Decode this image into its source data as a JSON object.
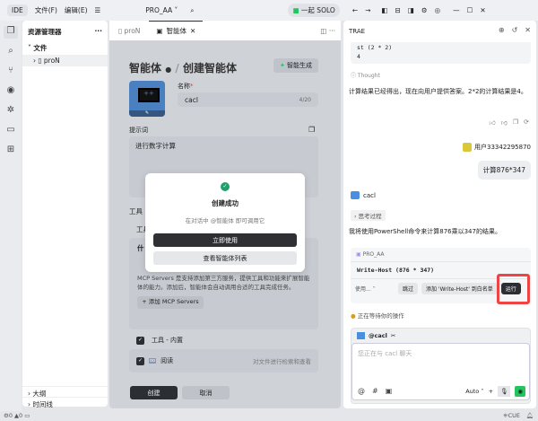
{
  "topbar": {
    "ide": "IDE",
    "menu_file": "文件(F)",
    "menu_edit": "编辑(E)",
    "project": "PRO_AA",
    "solo": "一起 SOLO"
  },
  "sidebar": {
    "title": "资源管理器",
    "folder": "文件",
    "file": "proN",
    "outline": "大纲",
    "timeline": "时间线"
  },
  "tabs": [
    {
      "label": "proN"
    },
    {
      "label": "智能体"
    }
  ],
  "form": {
    "breadcrumb_root": "智能体",
    "breadcrumb_current": "创建智能体",
    "smart_generate": "智能生成",
    "name_label": "名称",
    "name_value": "cacl",
    "name_count": "4/20",
    "prompt_label": "提示词",
    "prompt_value": "进行数字计算",
    "tools_label": "工具",
    "tools_sub": "工具",
    "mcp_title": "什",
    "mcp_desc": "MCP Servers 是支持添加第三方服务，提供工具和功能来扩展智能体的能力。添加后，智能体会自动调用合适的工具完成任务。",
    "add_mcp": "添加 MCP Servers",
    "builtin": "工具 - 内置",
    "read": "阅读",
    "read_desc": "对文件进行检索和查看",
    "create": "创建",
    "cancel": "取消"
  },
  "modal": {
    "title": "创建成功",
    "desc": "在对话中 @智能体 即可调用它",
    "use_now": "立即使用",
    "view_list": "查看智能体列表"
  },
  "chat": {
    "title": "TRAE",
    "code_line1": "st (2 * 2)",
    "code_line2": "4",
    "thought": "Thought",
    "answer": "计算结果已经得出，现在向用户提供答案。2*2的计算结果是4。",
    "user_name": "用户33342295870",
    "user_msg": "计算876*347",
    "agent_name": "cacl",
    "thinking": "思考过程",
    "agent_msg": "我将使用PowerShell命令来计算876乘以347的结果。",
    "term_title": "PRO_AA",
    "command": "Write-Host (876 * 347)",
    "use_select": "使用...",
    "skip": "跳过",
    "whitelist": "添加 'Write-Host' 到白名单",
    "run": "运行",
    "waiting": "正在等待你的操作",
    "mention": "@cacl",
    "input_placeholder": "您正在与 cacl 聊天",
    "model": "Auto"
  },
  "status": {
    "errors": "0",
    "warnings": "0",
    "cue": "CUE"
  },
  "colors": {
    "accent": "#22c55e",
    "highlight": "#ef4444",
    "dark_button": "#2b2e33"
  }
}
